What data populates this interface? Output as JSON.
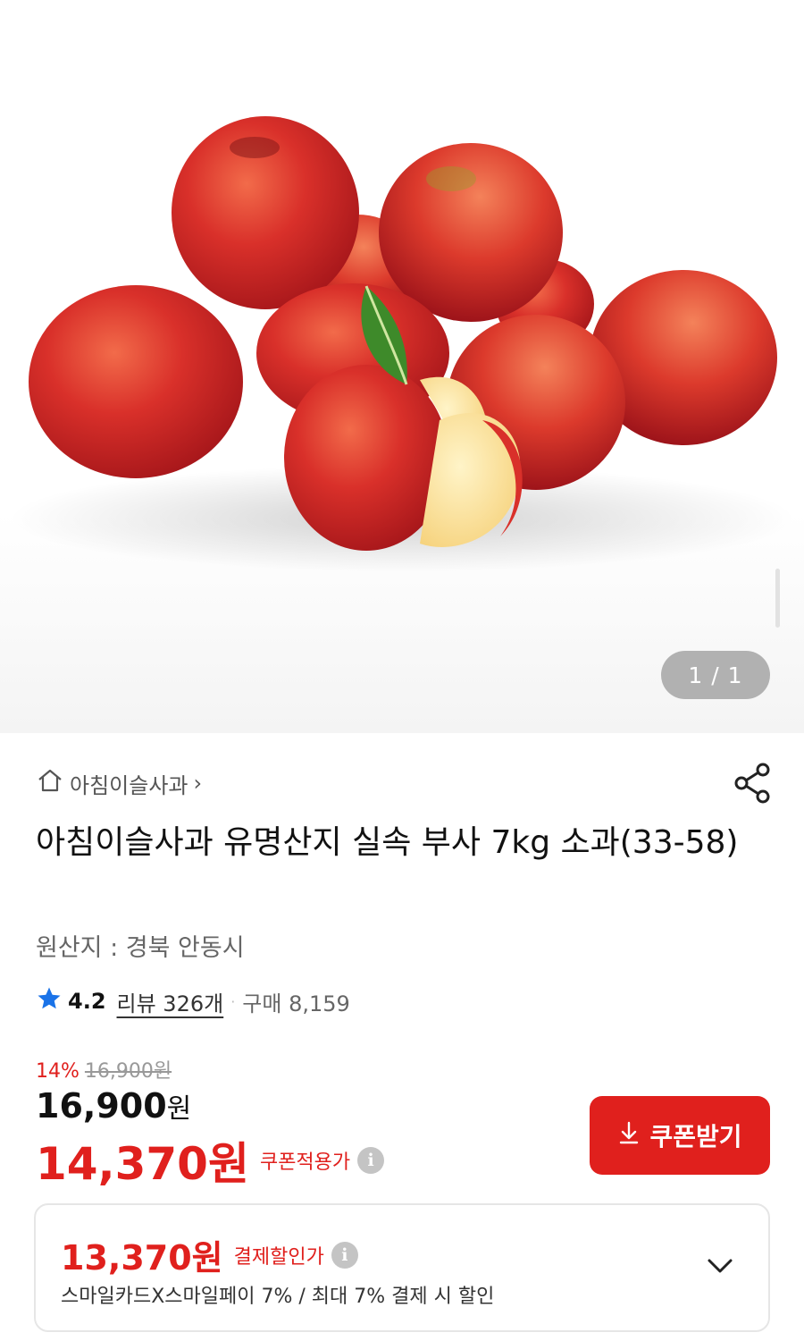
{
  "gallery": {
    "counter": "1 / 1"
  },
  "store": {
    "name": "아침이슬사과",
    "arrow": "›"
  },
  "product": {
    "title": "아침이슬사과 유명산지 실속 부사 7kg 소과(33-58)",
    "origin": "원산지 : 경북 안동시"
  },
  "rating": {
    "score": "4.2",
    "review": "리뷰 326개",
    "separator": "·",
    "purchases": "구매 8,159"
  },
  "price": {
    "discount_rate": "14%",
    "original": "16,900원",
    "sale": "16,900",
    "sale_unit": "원",
    "coupon_price": "14,370원",
    "coupon_label": "쿠폰적용가",
    "coupon_button": "쿠폰받기"
  },
  "payment": {
    "price": "13,370원",
    "label": "결제할인가",
    "desc": "스마일카드X스마일페이 7% / 최대 7% 결제 시 할인"
  },
  "colors": {
    "accent": "#e0201d"
  },
  "icons": {
    "home": "home-icon",
    "share": "share-icon",
    "star": "star-icon",
    "info": "info-icon",
    "download": "download-icon",
    "chevron": "chevron-down-icon"
  }
}
